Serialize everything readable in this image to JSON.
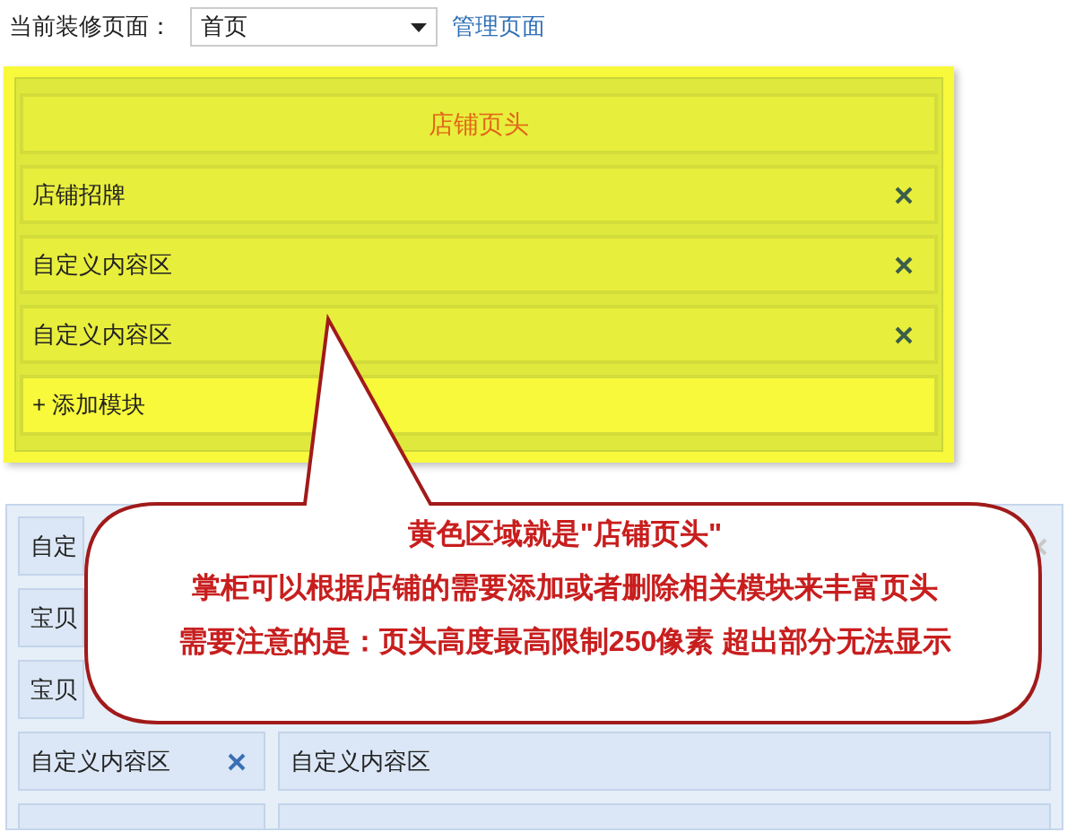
{
  "toolbar": {
    "label": "当前装修页面：",
    "page_select": {
      "value": "首页"
    },
    "manage_link": "管理页面"
  },
  "header_area": {
    "title": "店铺页头",
    "modules": [
      {
        "label": "店铺招牌",
        "removable": true
      },
      {
        "label": "自定义内容区",
        "removable": true
      },
      {
        "label": "自定义内容区",
        "removable": true
      }
    ],
    "add_button": "+ 添加模块"
  },
  "layout_area": {
    "rows": [
      {
        "cells": [
          {
            "label": "自定",
            "removable": true
          }
        ]
      },
      {
        "cells": [
          {
            "label": "宝贝",
            "removable": false
          }
        ]
      },
      {
        "cells": [
          {
            "label": "宝贝",
            "removable": false
          }
        ]
      },
      {
        "cells": [
          {
            "label": "自定义内容区",
            "removable": true
          },
          {
            "label": "自定义内容区",
            "removable": false
          }
        ]
      },
      {
        "cells": [
          {},
          {}
        ]
      }
    ]
  },
  "callout": {
    "lines": [
      "黄色区域就是\"店铺页头\"",
      "掌柜可以根据店铺的需要添加或者删除相关模块来丰富页头",
      "需要注意的是：页头高度最高限制250像素 超出部分无法显示"
    ]
  }
}
